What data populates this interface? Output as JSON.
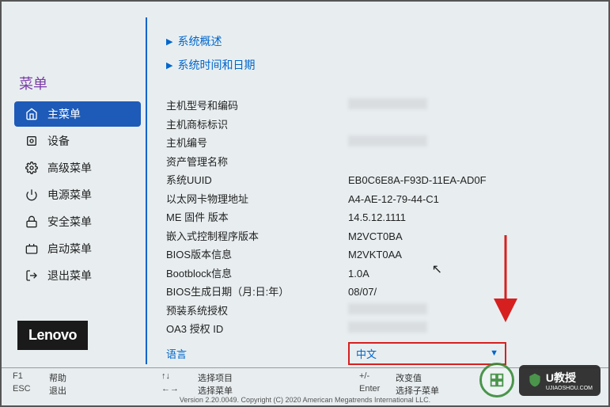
{
  "sidebar": {
    "title": "菜单",
    "items": [
      {
        "label": "主菜单"
      },
      {
        "label": "设备"
      },
      {
        "label": "高级菜单"
      },
      {
        "label": "电源菜单"
      },
      {
        "label": "安全菜单"
      },
      {
        "label": "启动菜单"
      },
      {
        "label": "退出菜单"
      }
    ]
  },
  "logo": "Lenovo",
  "content": {
    "nav1": "系统概述",
    "nav2": "系统时间和日期",
    "rows": [
      {
        "label": "主机型号和编码",
        "value": ""
      },
      {
        "label": "主机商标标识",
        "value": ""
      },
      {
        "label": "主机编号",
        "value": ""
      },
      {
        "label": "资产管理名称",
        "value": ""
      },
      {
        "label": "系统UUID",
        "value": "EB0C6E8A-F93D-11EA-AD0F"
      },
      {
        "label": "以太网卡物理地址",
        "value": "A4-AE-12-79-44-C1"
      },
      {
        "label": "ME 固件 版本",
        "value": "14.5.12.1111"
      },
      {
        "label": "嵌入式控制程序版本",
        "value": "M2VCT0BA"
      },
      {
        "label": "BIOS版本信息",
        "value": "M2VKT0AA"
      },
      {
        "label": "Bootblock信息",
        "value": "1.0A"
      },
      {
        "label": "BIOS生成日期（月:日:年）",
        "value": "08/07/"
      },
      {
        "label": "预装系统授权",
        "value": ""
      },
      {
        "label": "OA3 授权 ID",
        "value": ""
      }
    ],
    "language": {
      "label": "语言",
      "value": "中文"
    }
  },
  "footer": {
    "f1": "F1",
    "f1_label": "帮助",
    "esc": "ESC",
    "esc_label": "退出",
    "arrows1": "↑↓",
    "arrows1_label": "选择项目",
    "arrows2": "←→",
    "arrows2_label": "选择菜单",
    "pm": "+/-",
    "pm_label": "改变值",
    "enter": "Enter",
    "enter_label": "选择子菜单",
    "copyright": "Version 2.20.0049. Copyright (C) 2020 American Megatrends International LLC."
  },
  "watermark": {
    "text": "U教授",
    "sub": "UJIAOSHOU.COM"
  }
}
